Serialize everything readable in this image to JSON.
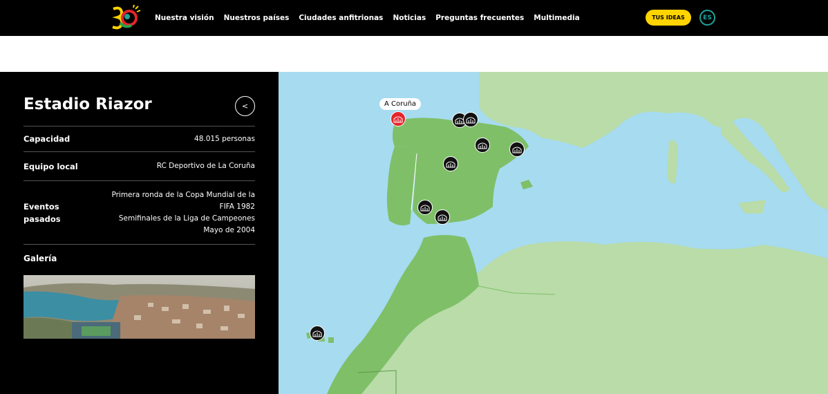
{
  "nav": {
    "items": [
      "Nuestra visión",
      "Nuestros países",
      "Ciudades anfitrionas",
      "Noticias",
      "Preguntas frecuentes",
      "Multimedia"
    ],
    "ideas_label": "TUS IDEAS",
    "lang_label": "ES"
  },
  "stadium": {
    "title": "Estadio Riazor",
    "back_label": "<",
    "capacity_label": "Capacidad",
    "capacity_value": "48.015 personas",
    "team_label": "Equipo local",
    "team_value": "RC Deportivo de La Coruña",
    "events_label": "Eventos pasados",
    "events": [
      "Primera ronda de la Copa Mundial de la FIFA 1982",
      "Semifinales de la Liga de Campeones Mayo de 2004"
    ],
    "gallery_label": "Galería"
  },
  "map": {
    "selected_city": "A Coruña",
    "colors": {
      "sea": "#a6dbf0",
      "host": "#7fbf68",
      "land": "#b9dca8",
      "pin": "#111111",
      "pin_active": "#e5252b"
    }
  }
}
